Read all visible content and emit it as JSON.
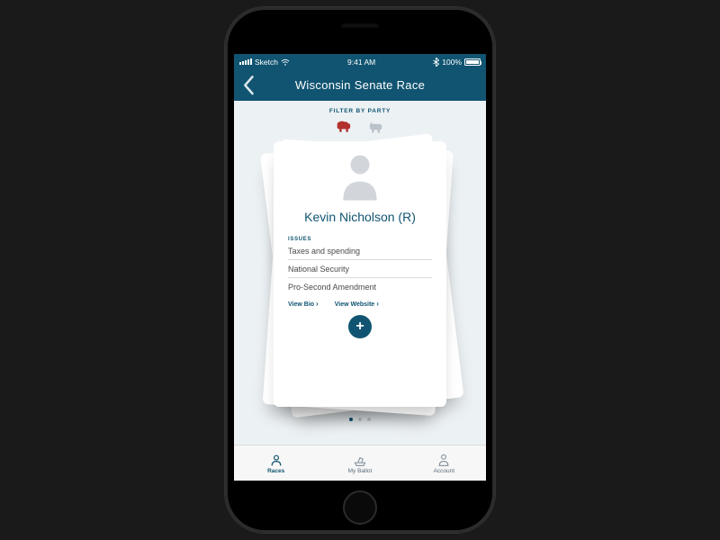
{
  "statusbar": {
    "carrier": "Sketch",
    "time": "9:41 AM",
    "battery": "100%"
  },
  "nav": {
    "title": "Wisconsin Senate Race"
  },
  "filter": {
    "label": "FILTER BY PARTY"
  },
  "candidate": {
    "name": "Kevin Nicholson (R)",
    "issues_label": "ISSUES",
    "issues": [
      "Taxes and spending",
      "National Security",
      "Pro-Second Amendment"
    ],
    "view_bio": "View Bio",
    "view_website": "View Website"
  },
  "tabs": {
    "races": "Races",
    "ballot": "My Ballot",
    "account": "Account"
  }
}
